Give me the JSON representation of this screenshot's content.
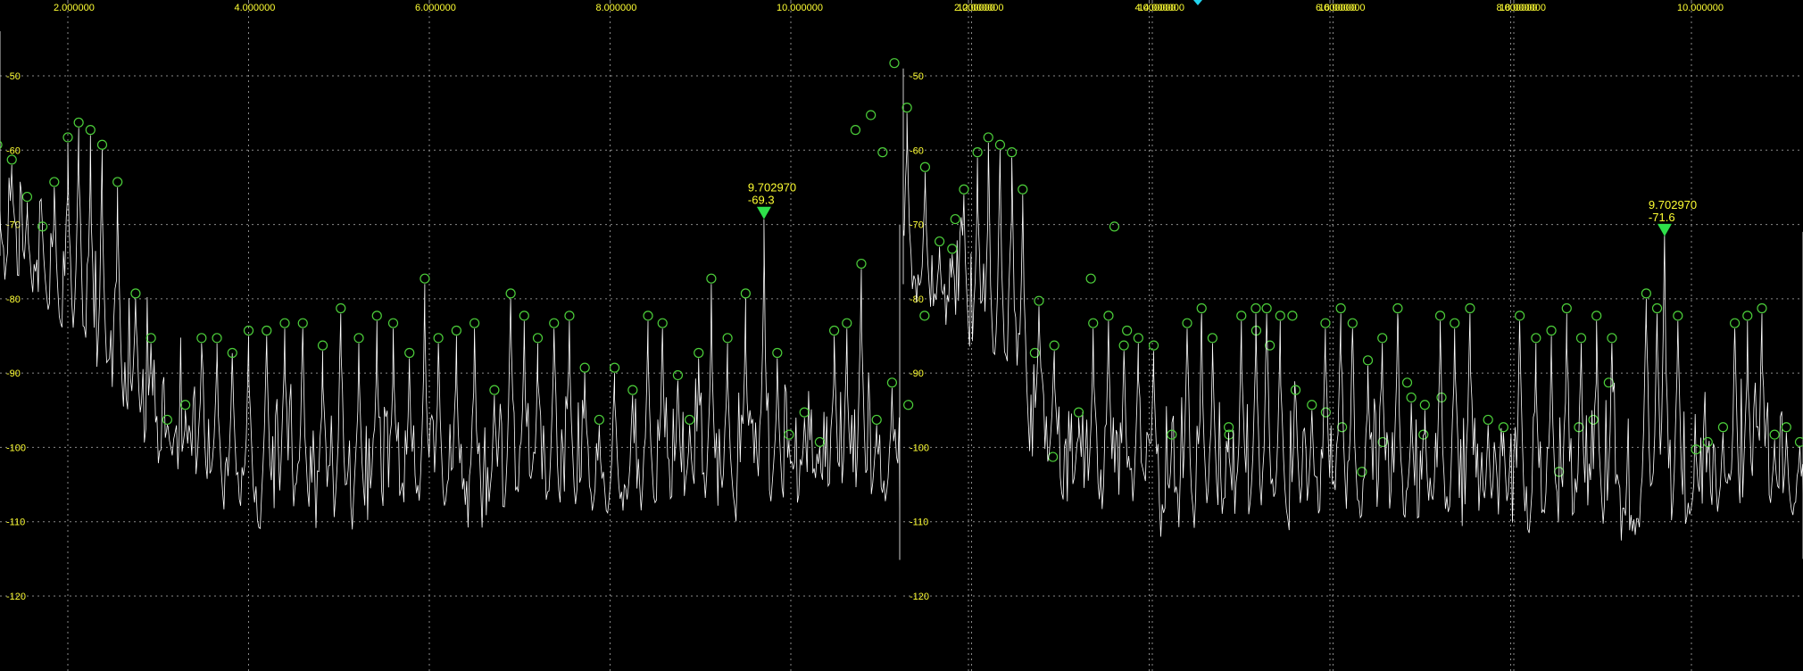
{
  "colors": {
    "background": "#000000",
    "grid": "#8a8a8a",
    "trace": "#ffffff",
    "tick_label": "#ffff33",
    "peak_circle": "#4ccf3a",
    "marker": "#2ee04a",
    "marker_label": "#ffff33",
    "top_indicator": "#22d3ee"
  },
  "chart_data": [
    {
      "type": "line",
      "panel": "left",
      "xlim": [
        0.5,
        19.8
      ],
      "ylim": [
        -128,
        -41
      ],
      "x_ticks": [
        2,
        4,
        6,
        8,
        10,
        12,
        14,
        16,
        18
      ],
      "x_tick_labels": [
        "2.000000",
        "4.000000",
        "6.000000",
        "8.000000",
        "10.000000",
        "12.000000",
        "14.000000",
        "16.000000",
        "18.000000"
      ],
      "y_ticks": [
        -50,
        -60,
        -70,
        -80,
        -90,
        -100,
        -110,
        -120
      ],
      "y_tick_labels": [
        "-50",
        "-60",
        "-70",
        "-80",
        "-90",
        "-100",
        "-110",
        "-120"
      ],
      "grid": true,
      "noise_floor": [
        [
          0.5,
          -72
        ],
        [
          1.2,
          -74
        ],
        [
          1.8,
          -82
        ],
        [
          2.4,
          -92
        ],
        [
          3.0,
          -100
        ],
        [
          3.6,
          -106
        ],
        [
          4.2,
          -108
        ],
        [
          5.5,
          -108
        ],
        [
          7.0,
          -108
        ],
        [
          9.0,
          -107
        ],
        [
          10.5,
          -107
        ],
        [
          11.8,
          -106
        ],
        [
          12.2,
          -110
        ],
        [
          14.0,
          -111
        ],
        [
          16.0,
          -112
        ],
        [
          18.0,
          -112
        ],
        [
          19.8,
          -113
        ]
      ],
      "peaks": [
        {
          "x": 0.62,
          "y": -52
        },
        {
          "x": 0.78,
          "y": -49
        },
        {
          "x": 0.95,
          "y": -56
        },
        {
          "x": 1.1,
          "y": -44
        },
        {
          "x": 1.22,
          "y": -60
        },
        {
          "x": 1.38,
          "y": -62
        },
        {
          "x": 1.55,
          "y": -67
        },
        {
          "x": 1.72,
          "y": -71
        },
        {
          "x": 1.85,
          "y": -65
        },
        {
          "x": 2.0,
          "y": -59
        },
        {
          "x": 2.12,
          "y": -57
        },
        {
          "x": 2.25,
          "y": -58
        },
        {
          "x": 2.38,
          "y": -60
        },
        {
          "x": 2.55,
          "y": -65
        },
        {
          "x": 2.75,
          "y": -80
        },
        {
          "x": 2.92,
          "y": -86
        },
        {
          "x": 3.1,
          "y": -97
        },
        {
          "x": 3.3,
          "y": -95
        },
        {
          "x": 3.48,
          "y": -86
        },
        {
          "x": 3.65,
          "y": -86
        },
        {
          "x": 3.82,
          "y": -88
        },
        {
          "x": 4.0,
          "y": -85
        },
        {
          "x": 4.2,
          "y": -85
        },
        {
          "x": 4.4,
          "y": -84
        },
        {
          "x": 4.6,
          "y": -84
        },
        {
          "x": 4.82,
          "y": -87
        },
        {
          "x": 5.02,
          "y": -82
        },
        {
          "x": 5.22,
          "y": -86
        },
        {
          "x": 5.42,
          "y": -83
        },
        {
          "x": 5.6,
          "y": -84
        },
        {
          "x": 5.78,
          "y": -88
        },
        {
          "x": 5.95,
          "y": -78
        },
        {
          "x": 6.1,
          "y": -86
        },
        {
          "x": 6.3,
          "y": -85
        },
        {
          "x": 6.5,
          "y": -84
        },
        {
          "x": 6.72,
          "y": -93
        },
        {
          "x": 6.9,
          "y": -80
        },
        {
          "x": 7.05,
          "y": -83
        },
        {
          "x": 7.2,
          "y": -86
        },
        {
          "x": 7.38,
          "y": -84
        },
        {
          "x": 7.55,
          "y": -83
        },
        {
          "x": 7.72,
          "y": -90
        },
        {
          "x": 7.88,
          "y": -97
        },
        {
          "x": 8.05,
          "y": -90
        },
        {
          "x": 8.25,
          "y": -93
        },
        {
          "x": 8.42,
          "y": -83
        },
        {
          "x": 8.58,
          "y": -84
        },
        {
          "x": 8.75,
          "y": -91
        },
        {
          "x": 8.88,
          "y": -97
        },
        {
          "x": 8.98,
          "y": -88
        },
        {
          "x": 9.12,
          "y": -78
        },
        {
          "x": 9.3,
          "y": -86
        },
        {
          "x": 9.5,
          "y": -80
        },
        {
          "x": 9.70297,
          "y": -69.3
        },
        {
          "x": 9.85,
          "y": -88
        },
        {
          "x": 9.98,
          "y": -99
        },
        {
          "x": 10.15,
          "y": -96
        },
        {
          "x": 10.32,
          "y": -100
        },
        {
          "x": 10.48,
          "y": -85
        },
        {
          "x": 10.62,
          "y": -84
        },
        {
          "x": 10.78,
          "y": -76
        },
        {
          "x": 10.95,
          "y": -97
        },
        {
          "x": 11.12,
          "y": -92
        },
        {
          "x": 11.3,
          "y": -95
        },
        {
          "x": 11.48,
          "y": -83
        },
        {
          "x": 11.82,
          "y": -70
        },
        {
          "x": 12.7,
          "y": -88
        },
        {
          "x": 12.9,
          "y": -102
        },
        {
          "x": 13.32,
          "y": -78
        },
        {
          "x": 13.58,
          "y": -71
        },
        {
          "x": 13.72,
          "y": -85
        },
        {
          "x": 14.85,
          "y": -99
        },
        {
          "x": 15.15,
          "y": -85
        },
        {
          "x": 15.3,
          "y": -87
        },
        {
          "x": 15.55,
          "y": -83
        },
        {
          "x": 15.92,
          "y": -96
        },
        {
          "x": 16.1,
          "y": -98
        },
        {
          "x": 16.32,
          "y": -104
        },
        {
          "x": 16.55,
          "y": -100
        },
        {
          "x": 16.82,
          "y": -92
        },
        {
          "x": 17.0,
          "y": -99
        },
        {
          "x": 17.2,
          "y": -94
        },
        {
          "x": 18.5,
          "y": -104
        },
        {
          "x": 18.72,
          "y": -98
        },
        {
          "x": 18.88,
          "y": -97
        },
        {
          "x": 19.05,
          "y": -92
        }
      ],
      "marker": {
        "x": 9.70297,
        "y": -69.3,
        "x_label": "9.702970",
        "y_label": "-69.3"
      }
    },
    {
      "type": "line",
      "panel": "right",
      "xlim": [
        0.5,
        19.8
      ],
      "ylim": [
        -128,
        -41
      ],
      "x_ticks": [
        2,
        4,
        6,
        8,
        10,
        12,
        14,
        16,
        18
      ],
      "x_tick_labels": [
        "2.000000",
        "4.000000",
        "6.000000",
        "8.000000",
        "10.000000",
        "12.000000",
        "14.000000",
        "16.000000",
        "18.000000"
      ],
      "y_ticks": [
        -50,
        -60,
        -70,
        -80,
        -90,
        -100,
        -110,
        -120
      ],
      "y_tick_labels": [
        "-50",
        "-60",
        "-70",
        "-80",
        "-90",
        "-100",
        "-110",
        "-120"
      ],
      "grid": true,
      "noise_floor": [
        [
          0.5,
          -75
        ],
        [
          1.2,
          -78
        ],
        [
          1.8,
          -84
        ],
        [
          2.4,
          -92
        ],
        [
          3.0,
          -104
        ],
        [
          3.6,
          -108
        ],
        [
          4.2,
          -109
        ],
        [
          6.0,
          -109
        ],
        [
          8.0,
          -110
        ],
        [
          10.0,
          -109
        ],
        [
          12.0,
          -109
        ],
        [
          14.0,
          -110
        ],
        [
          16.0,
          -111
        ],
        [
          18.0,
          -112
        ],
        [
          19.8,
          -112
        ]
      ],
      "peaks": [
        {
          "x": 0.75,
          "y": -58
        },
        {
          "x": 0.92,
          "y": -56
        },
        {
          "x": 1.05,
          "y": -61
        },
        {
          "x": 1.18,
          "y": -49
        },
        {
          "x": 1.32,
          "y": -55
        },
        {
          "x": 1.52,
          "y": -63
        },
        {
          "x": 1.68,
          "y": -73
        },
        {
          "x": 1.82,
          "y": -74
        },
        {
          "x": 1.95,
          "y": -66
        },
        {
          "x": 2.1,
          "y": -61
        },
        {
          "x": 2.22,
          "y": -59
        },
        {
          "x": 2.35,
          "y": -60
        },
        {
          "x": 2.48,
          "y": -61
        },
        {
          "x": 2.6,
          "y": -66
        },
        {
          "x": 2.78,
          "y": -81
        },
        {
          "x": 2.95,
          "y": -87
        },
        {
          "x": 3.22,
          "y": -96
        },
        {
          "x": 3.38,
          "y": -84
        },
        {
          "x": 3.55,
          "y": -83
        },
        {
          "x": 3.72,
          "y": -87
        },
        {
          "x": 3.88,
          "y": -86
        },
        {
          "x": 4.05,
          "y": -87
        },
        {
          "x": 4.25,
          "y": -99
        },
        {
          "x": 4.42,
          "y": -84
        },
        {
          "x": 4.58,
          "y": -82
        },
        {
          "x": 4.7,
          "y": -86
        },
        {
          "x": 4.88,
          "y": -98
        },
        {
          "x": 5.02,
          "y": -83
        },
        {
          "x": 5.18,
          "y": -82
        },
        {
          "x": 5.3,
          "y": -82
        },
        {
          "x": 5.45,
          "y": -83
        },
        {
          "x": 5.62,
          "y": -93
        },
        {
          "x": 5.8,
          "y": -95
        },
        {
          "x": 5.95,
          "y": -84
        },
        {
          "x": 6.12,
          "y": -82
        },
        {
          "x": 6.25,
          "y": -84
        },
        {
          "x": 6.42,
          "y": -89
        },
        {
          "x": 6.58,
          "y": -86
        },
        {
          "x": 6.75,
          "y": -82
        },
        {
          "x": 6.9,
          "y": -94
        },
        {
          "x": 7.05,
          "y": -95
        },
        {
          "x": 7.22,
          "y": -83
        },
        {
          "x": 7.38,
          "y": -84
        },
        {
          "x": 7.55,
          "y": -82
        },
        {
          "x": 7.75,
          "y": -97
        },
        {
          "x": 7.92,
          "y": -98
        },
        {
          "x": 8.1,
          "y": -83
        },
        {
          "x": 8.28,
          "y": -86
        },
        {
          "x": 8.45,
          "y": -85
        },
        {
          "x": 8.62,
          "y": -82
        },
        {
          "x": 8.78,
          "y": -86
        },
        {
          "x": 8.95,
          "y": -83
        },
        {
          "x": 9.12,
          "y": -86
        },
        {
          "x": 9.5,
          "y": -80
        },
        {
          "x": 9.62,
          "y": -82
        },
        {
          "x": 9.70297,
          "y": -71.6
        },
        {
          "x": 9.85,
          "y": -83
        },
        {
          "x": 10.05,
          "y": -101
        },
        {
          "x": 10.18,
          "y": -100
        },
        {
          "x": 10.35,
          "y": -98
        },
        {
          "x": 10.48,
          "y": -84
        },
        {
          "x": 10.62,
          "y": -83
        },
        {
          "x": 10.78,
          "y": -82
        },
        {
          "x": 10.92,
          "y": -99
        },
        {
          "x": 11.05,
          "y": -98
        },
        {
          "x": 11.2,
          "y": -100
        },
        {
          "x": 11.38,
          "y": -82
        },
        {
          "x": 11.52,
          "y": -71
        },
        {
          "x": 11.7,
          "y": -87
        },
        {
          "x": 11.88,
          "y": -98
        },
        {
          "x": 12.05,
          "y": -101
        },
        {
          "x": 12.22,
          "y": -84
        },
        {
          "x": 12.38,
          "y": -86
        },
        {
          "x": 12.55,
          "y": -84
        },
        {
          "x": 12.72,
          "y": -101
        },
        {
          "x": 12.88,
          "y": -96
        },
        {
          "x": 13.02,
          "y": -82
        },
        {
          "x": 13.15,
          "y": -75
        },
        {
          "x": 13.32,
          "y": -84
        },
        {
          "x": 13.5,
          "y": -103
        },
        {
          "x": 13.72,
          "y": -86
        },
        {
          "x": 13.85,
          "y": -82
        },
        {
          "x": 14.02,
          "y": -91
        },
        {
          "x": 14.18,
          "y": -84
        },
        {
          "x": 14.32,
          "y": -91
        },
        {
          "x": 14.45,
          "y": -89
        },
        {
          "x": 14.6,
          "y": -86
        },
        {
          "x": 14.75,
          "y": -86
        },
        {
          "x": 14.92,
          "y": -83
        },
        {
          "x": 15.08,
          "y": -86
        },
        {
          "x": 15.25,
          "y": -84
        },
        {
          "x": 15.42,
          "y": -86
        },
        {
          "x": 15.58,
          "y": -82
        },
        {
          "x": 15.75,
          "y": -84
        },
        {
          "x": 15.9,
          "y": -83
        },
        {
          "x": 16.08,
          "y": -82
        },
        {
          "x": 16.25,
          "y": -97
        },
        {
          "x": 16.42,
          "y": -86
        },
        {
          "x": 16.58,
          "y": -83
        },
        {
          "x": 16.75,
          "y": -83
        },
        {
          "x": 16.92,
          "y": -94
        },
        {
          "x": 17.08,
          "y": -104
        },
        {
          "x": 17.25,
          "y": -86
        },
        {
          "x": 17.42,
          "y": -83
        },
        {
          "x": 17.58,
          "y": -82
        },
        {
          "x": 17.75,
          "y": -83
        },
        {
          "x": 17.92,
          "y": -103
        },
        {
          "x": 18.08,
          "y": -86
        },
        {
          "x": 18.25,
          "y": -82
        },
        {
          "x": 18.42,
          "y": -83
        },
        {
          "x": 18.58,
          "y": -78
        },
        {
          "x": 18.75,
          "y": -81
        },
        {
          "x": 18.92,
          "y": -77
        },
        {
          "x": 19.08,
          "y": -81
        },
        {
          "x": 19.25,
          "y": -80
        }
      ],
      "marker": {
        "x": 9.70297,
        "y": -71.6,
        "x_label": "9.702970",
        "y_label": "-71.6"
      }
    }
  ]
}
